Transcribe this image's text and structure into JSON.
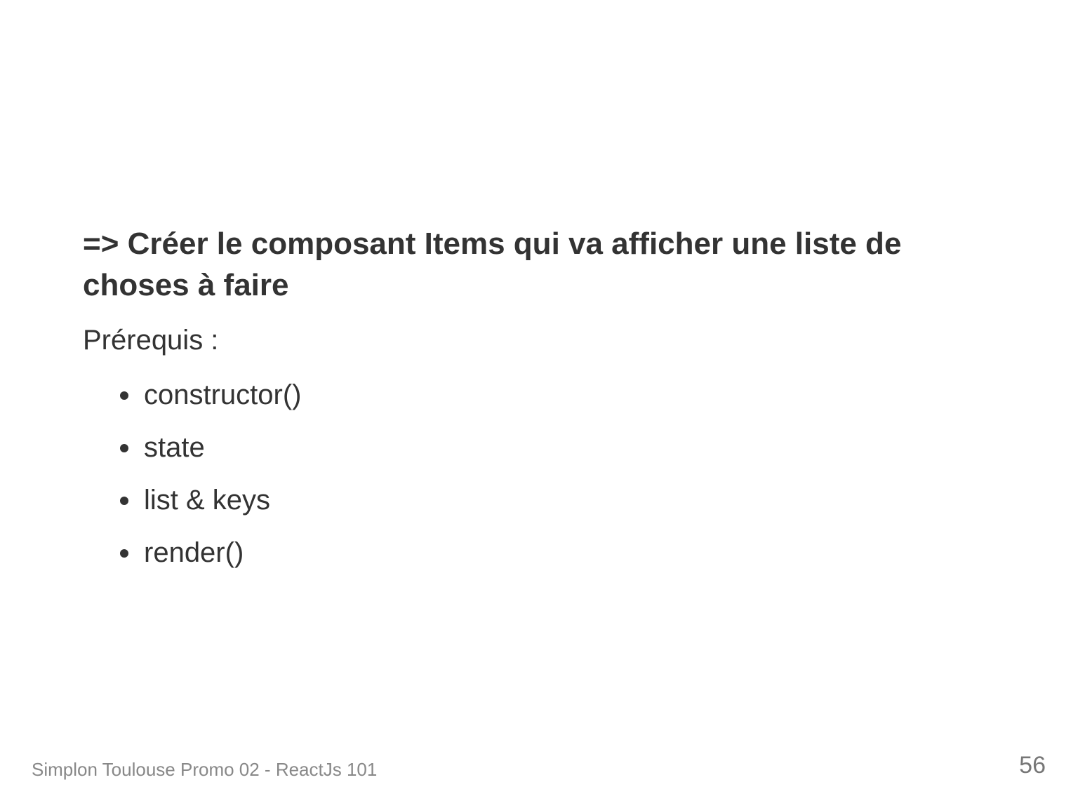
{
  "slide": {
    "heading": "=> Créer le composant Items qui va afficher une liste de choses à faire",
    "prereq_label": "Prérequis :",
    "bullets": [
      {
        "text": "constructor()"
      },
      {
        "text": "state"
      },
      {
        "text": "list & keys"
      },
      {
        "text": "render()"
      }
    ]
  },
  "footer": {
    "caption": "Simplon Toulouse Promo 02 - ReactJs 101",
    "page_number": "56"
  }
}
